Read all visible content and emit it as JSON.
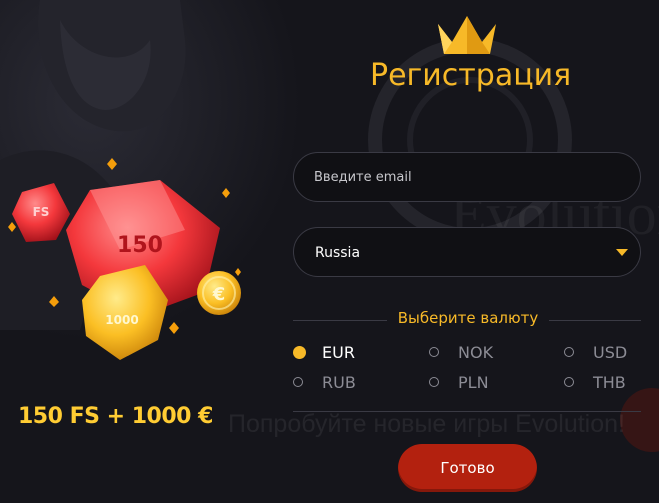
{
  "registration": {
    "title": "Регистрация",
    "email_placeholder": "Введите email",
    "country_value": "Russia",
    "currency_title": "Выберите валюту",
    "currencies": [
      {
        "code": "EUR",
        "selected": true
      },
      {
        "code": "NOK",
        "selected": false
      },
      {
        "code": "USD",
        "selected": false
      },
      {
        "code": "RUB",
        "selected": false
      },
      {
        "code": "PLN",
        "selected": false
      },
      {
        "code": "THB",
        "selected": false
      }
    ],
    "submit_label": "Готово"
  },
  "promo": {
    "bonus_text": "150 FS + 1000 €",
    "background_text": "Попробуйте новые игры Evolution!",
    "brand_text": "Evolution Gaming",
    "gem_labels": [
      "FS",
      "150",
      "1000",
      "€"
    ]
  },
  "icons": [
    "crown-icon",
    "chevron-down-icon"
  ],
  "colors": {
    "accent": "#f7b928",
    "button": "#b3210f",
    "background": "#15151b",
    "field_border": "#3a3a44",
    "bonus": "#ffcc33"
  }
}
